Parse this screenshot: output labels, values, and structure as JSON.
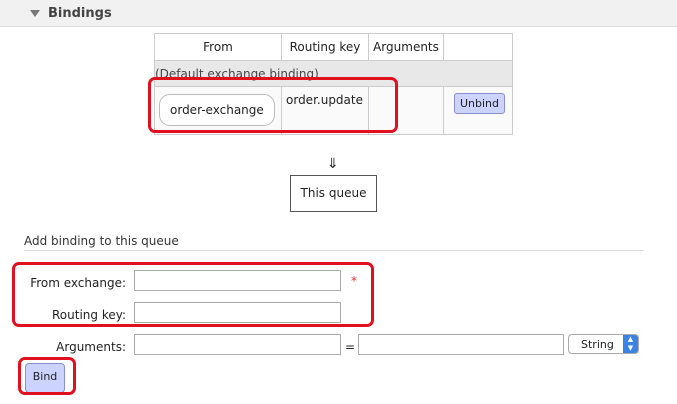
{
  "section": {
    "title": "Bindings"
  },
  "bindings_table": {
    "headers": [
      "From",
      "Routing key",
      "Arguments",
      ""
    ],
    "default_row": "(Default exchange binding)",
    "rows": [
      {
        "from": "order-exchange",
        "routing_key": "order.update",
        "arguments": "",
        "action": "Unbind"
      }
    ]
  },
  "flow": {
    "arrow": "⇓",
    "target": "This queue"
  },
  "add_binding": {
    "title": "Add binding to this queue",
    "from_label": "From exchange:",
    "from_value": "",
    "required_mark": "*",
    "routing_label": "Routing key:",
    "routing_value": "",
    "arguments_label": "Arguments:",
    "arg_key": "",
    "equals": "=",
    "arg_value": "",
    "type_select": "String",
    "bind_label": "Bind"
  },
  "colors": {
    "highlight": "#e0101e",
    "button": "#ccd3ff",
    "select_accent": "#3b82e6"
  }
}
